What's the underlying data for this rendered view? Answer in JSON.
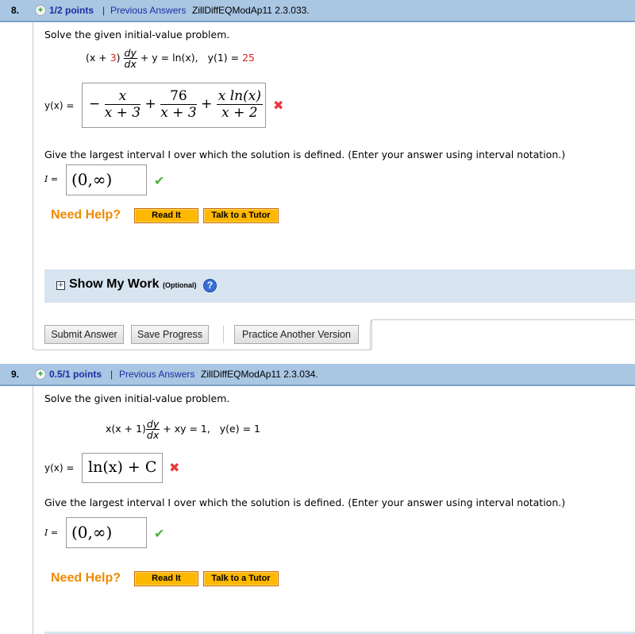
{
  "questions": [
    {
      "number": "8.",
      "points": "1/2 points",
      "separator": "|",
      "previous_answers": "Previous Answers",
      "code": "ZillDiffEQModAp11 2.3.033.",
      "prompt": "Solve the given initial-value problem.",
      "equation": {
        "lhs_prefix": "(x + ",
        "lhs_coef_red": "3",
        "lhs_close": ")",
        "deriv_num": "dy",
        "deriv_den": "dx",
        "rest": "+ y = ln(x),",
        "initial_cond": "y(1) = ",
        "initial_value_red": "25"
      },
      "answer_label": "y(x) =",
      "answer_terms": {
        "sign1": "−",
        "t1_num": "x",
        "t1_den": "x + 3",
        "plus1": "+",
        "t2_num": "76",
        "t2_den": "x + 3",
        "plus2": "+",
        "t3_num": "x ln(x)",
        "t3_den": "x + 2"
      },
      "answer_status": "incorrect",
      "interval_prompt": "Give the largest interval I over which the solution is defined. (Enter your answer using interval notation.)",
      "interval_label": "I =",
      "interval_value": "(0,∞)",
      "interval_status": "correct",
      "need_help": "Need Help?",
      "read_it": "Read It",
      "talk_tutor": "Talk to a Tutor",
      "show_my_work": "Show My Work",
      "show_my_work_optional": "(Optional)",
      "buttons": {
        "submit": "Submit Answer",
        "save": "Save Progress",
        "practice": "Practice Another Version"
      }
    },
    {
      "number": "9.",
      "points": "0.5/1 points",
      "separator": "|",
      "previous_answers": "Previous Answers",
      "code": "ZillDiffEQModAp11 2.3.034.",
      "prompt": "Solve the given initial-value problem.",
      "equation": {
        "lhs_prefix": "x(x + 1)",
        "deriv_num": "dy",
        "deriv_den": "dx",
        "rest": "+ xy = 1,",
        "initial_cond": "y(e) = 1"
      },
      "answer_label": "y(x) =",
      "answer_value": "ln(x) + C",
      "answer_status": "incorrect",
      "interval_prompt": "Give the largest interval I over which the solution is defined. (Enter your answer using interval notation.)",
      "interval_label": "I =",
      "interval_value": "(0,∞)",
      "interval_status": "correct",
      "need_help": "Need Help?",
      "read_it": "Read It",
      "talk_tutor": "Talk to a Tutor"
    }
  ],
  "icons": {
    "plus": "+",
    "incorrect": "✖",
    "correct": "✔",
    "expand": "+",
    "help": "?"
  },
  "colors": {
    "header_bg": "#a9c6e3",
    "link_blue": "#1a2fa0",
    "incorrect_red": "#e8383d",
    "correct_green": "#4caf3a",
    "need_help_orange": "#f08a00",
    "button_orange": "#ffb800",
    "show_work_bg": "#d8e5f0"
  }
}
